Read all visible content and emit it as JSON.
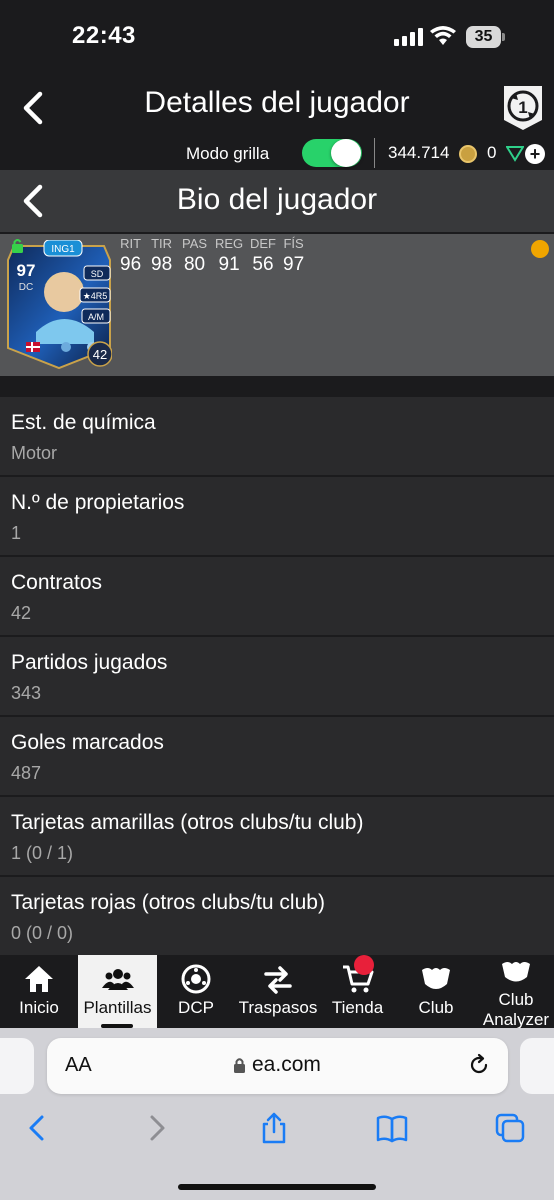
{
  "status_bar": {
    "time": "22:43",
    "battery": "35"
  },
  "header": {
    "title": "Detalles del jugador"
  },
  "toolbar": {
    "grid_label": "Modo grilla",
    "grid_enabled": true,
    "coins": "344.714",
    "points": "0"
  },
  "section": {
    "title": "Bio del jugador"
  },
  "player": {
    "rating": "97",
    "position": "DC",
    "chem_badge": "ING1",
    "alt_position": "SD",
    "skill_weak": "★4R5",
    "work_rate": "A/M",
    "contracts_badge": "42",
    "stats": [
      {
        "label": "RIT",
        "value": "96"
      },
      {
        "label": "TIR",
        "value": "98"
      },
      {
        "label": "PAS",
        "value": "80"
      },
      {
        "label": "REG",
        "value": "91"
      },
      {
        "label": "DEF",
        "value": "56"
      },
      {
        "label": "FÍS",
        "value": "97"
      }
    ]
  },
  "info_rows": [
    {
      "label": "Est. de química",
      "value": "Motor"
    },
    {
      "label": "N.º de propietarios",
      "value": "1"
    },
    {
      "label": "Contratos",
      "value": "42"
    },
    {
      "label": "Partidos jugados",
      "value": "343"
    },
    {
      "label": "Goles marcados",
      "value": "487"
    },
    {
      "label": "Tarjetas amarillas (otros clubs/tu club)",
      "value": "1 (0 / 1)"
    },
    {
      "label": "Tarjetas rojas (otros clubs/tu club)",
      "value": "0 (0 / 0)"
    }
  ],
  "nav": [
    {
      "label": "Inicio",
      "icon": "home-icon"
    },
    {
      "label": "Plantillas",
      "icon": "squads-icon",
      "active": true
    },
    {
      "label": "DCP",
      "icon": "sbc-icon"
    },
    {
      "label": "Traspasos",
      "icon": "transfers-icon"
    },
    {
      "label": "Tienda",
      "icon": "cart-icon",
      "badge": true
    },
    {
      "label": "Club",
      "icon": "club-icon"
    },
    {
      "label": "Club Analyzer",
      "icon": "club-analyzer-icon"
    }
  ],
  "browser": {
    "aa": "AA",
    "url": "ea.com"
  },
  "colors": {
    "accent_green": "#28d26a",
    "badge_red": "#e8203a",
    "card_blue": "#1f7fe0",
    "ios_blue": "#1a7cf5"
  }
}
